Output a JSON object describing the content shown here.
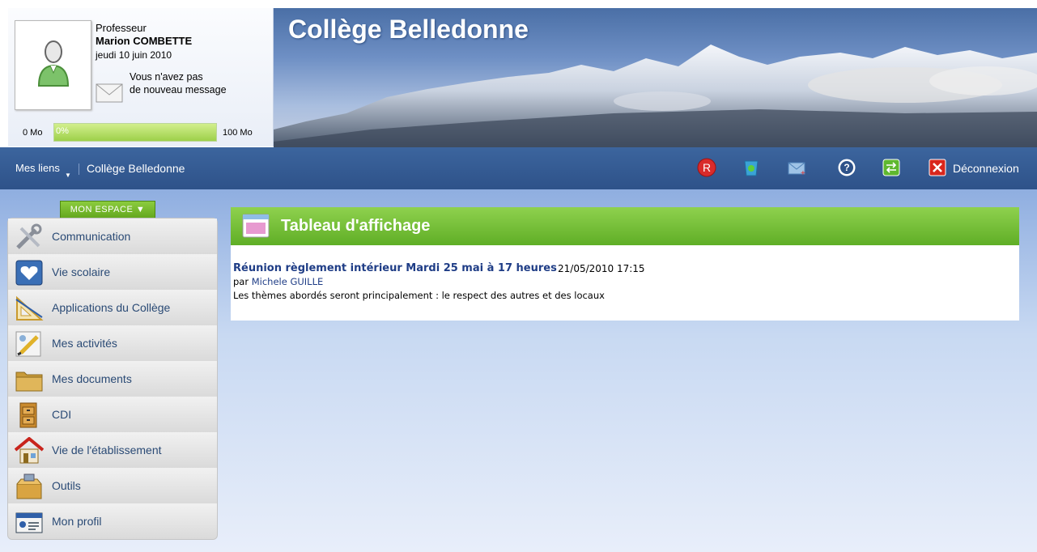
{
  "user": {
    "role": "Professeur",
    "name": "Marion COMBETTE",
    "date": "jeudi 10 juin 2010",
    "message_line1": "Vous n'avez pas",
    "message_line2": "de nouveau message",
    "quota_min": "0 Mo",
    "quota_percent_label": "0%",
    "quota_max": "100 Mo",
    "quota_used": 0
  },
  "banner": {
    "title": "Collège Belledonne"
  },
  "navbar": {
    "links_label": "Mes liens",
    "school_link": "Collège Belledonne",
    "icons": [
      "r-badge-icon",
      "recycle-bin-icon",
      "mail-compose-icon",
      "help-icon",
      "switch-icon",
      "logout-icon"
    ],
    "logout_label": "Déconnexion"
  },
  "sidebar": {
    "tab_label": "MON ESPACE ▼",
    "items": [
      {
        "label": "Communication",
        "icon": "tools-icon"
      },
      {
        "label": "Vie scolaire",
        "icon": "heart-screen-icon"
      },
      {
        "label": "Applications du Collège",
        "icon": "set-square-icon"
      },
      {
        "label": "Mes activités",
        "icon": "pencil-board-icon"
      },
      {
        "label": "Mes documents",
        "icon": "folder-icon"
      },
      {
        "label": "CDI",
        "icon": "cabinet-icon"
      },
      {
        "label": "Vie de l'établissement",
        "icon": "house-icon"
      },
      {
        "label": "Outils",
        "icon": "toolbox-icon"
      },
      {
        "label": "Mon profil",
        "icon": "id-card-icon"
      }
    ]
  },
  "board": {
    "title": "Tableau d'affichage",
    "news": {
      "title": "Réunion règlement intérieur Mardi 25 mai à 17 heures",
      "date": "21/05/2010 17:15",
      "by_prefix": "par",
      "author": "Michele GUILLE",
      "body": "Les thèmes abordés seront principalement : le respect des autres et des locaux"
    }
  },
  "colors": {
    "nav_blue": "#2e5289",
    "accent_green": "#6ab52f",
    "link_blue": "#1f3d86"
  }
}
